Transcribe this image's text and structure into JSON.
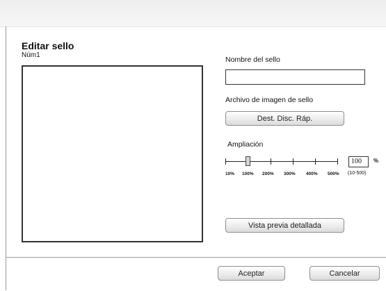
{
  "dialog": {
    "title": "Editar sello",
    "stamp_number": "Núm1"
  },
  "form": {
    "name_label": "Nombre del sello",
    "name_value": "",
    "image_label": "Archivo de imagen de sello",
    "browse_button": "Dest. Disc. Ráp.",
    "zoom_label": "Ampliación",
    "zoom_value": "100",
    "zoom_unit": "%",
    "zoom_range": "(10-500)",
    "zoom_ticks": [
      "10%",
      "100%",
      "200%",
      "300%",
      "400%",
      "500%"
    ],
    "preview_button": "Vista previa detallada"
  },
  "footer": {
    "accept_button": "Aceptar",
    "cancel_button": "Cancelar"
  }
}
